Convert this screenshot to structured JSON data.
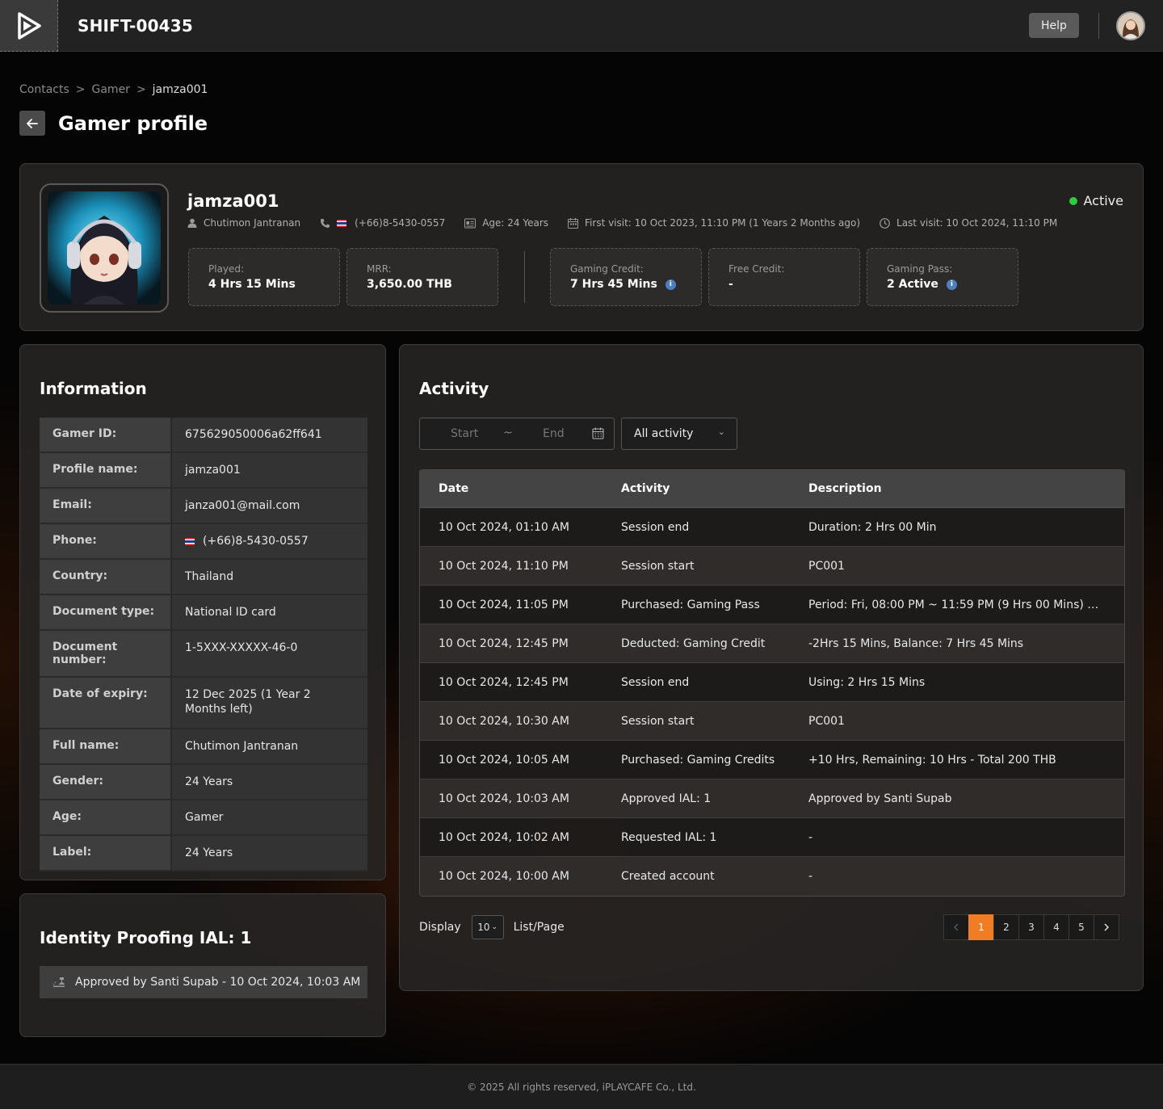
{
  "app": {
    "shift_id": "SHIFT-00435",
    "help_label": "Help"
  },
  "breadcrumb": [
    "Contacts",
    "Gamer",
    "jamza001"
  ],
  "page_title": "Gamer profile",
  "profile": {
    "name": "jamza001",
    "status": "Active",
    "status_color": "#2ecc40",
    "meta": {
      "full_name": "Chutimon Jantranan",
      "phone": "(+66)8-5430-0557",
      "age": "Age: 24 Years",
      "first_visit": "First visit: 10 Oct 2023, 11:10 PM (1 Years 2 Months ago)",
      "last_visit": "Last visit: 10 Oct 2024, 11:10 PM"
    },
    "stats": [
      {
        "label": "Played:",
        "value": "4 Hrs 15 Mins",
        "info": false
      },
      {
        "label": "MRR:",
        "value": "3,650.00 THB",
        "info": false
      },
      {
        "label": "Gaming Credit:",
        "value": "7 Hrs 45 Mins",
        "info": true
      },
      {
        "label": "Free Credit:",
        "value": "-",
        "info": false
      },
      {
        "label": "Gaming Pass:",
        "value": "2 Active",
        "info": true
      }
    ]
  },
  "information": {
    "title": "Information",
    "rows": [
      {
        "key": "Gamer ID:",
        "value": "675629050006a62ff641"
      },
      {
        "key": "Profile name:",
        "value": "jamza001"
      },
      {
        "key": "Email:",
        "value": "janza001@mail.com"
      },
      {
        "key": "Phone:",
        "value": "(+66)8-5430-0557"
      },
      {
        "key": "Country:",
        "value": "Thailand"
      },
      {
        "key": "Document type:",
        "value": "National ID card"
      },
      {
        "key": "Document number:",
        "value": "1-5XXX-XXXXX-46-0"
      },
      {
        "key": "Date of expiry:",
        "value": "12 Dec 2025 (1 Year 2 Months left)"
      },
      {
        "key": "Full name:",
        "value": "Chutimon Jantranan"
      },
      {
        "key": "Gender:",
        "value": "24 Years"
      },
      {
        "key": "Age:",
        "value": "Gamer"
      },
      {
        "key": "Label:",
        "value": "24 Years"
      }
    ]
  },
  "identity": {
    "title": "Identity Proofing IAL: 1",
    "approval": "Approved by Santi Supab - 10 Oct 2024, 10:03 AM"
  },
  "activity": {
    "title": "Activity",
    "date_start_placeholder": "Start",
    "date_separator": "~",
    "date_end_placeholder": "End",
    "filter_value": "All activity",
    "columns": [
      "Date",
      "Activity",
      "Description"
    ],
    "rows": [
      {
        "date": "10 Oct 2024, 01:10 AM",
        "activity": "Session end",
        "description": "Duration: 2 Hrs 00 Min"
      },
      {
        "date": "10 Oct 2024, 11:10 PM",
        "activity": "Session start",
        "description": "PC001"
      },
      {
        "date": "10 Oct 2024, 11:05 PM",
        "activity": "Purchased: Gaming Pass",
        "description": "Period: Fri, 08:00 PM ~ 11:59 PM (9 Hrs 00 Mins) - T..."
      },
      {
        "date": "10 Oct 2024, 12:45 PM",
        "activity": "Deducted: Gaming Credit",
        "description": "-2Hrs 15 Mins,  Balance: 7 Hrs 45 Mins"
      },
      {
        "date": "10 Oct 2024, 12:45 PM",
        "activity": "Session end",
        "description": "Using: 2 Hrs 15 Mins"
      },
      {
        "date": "10 Oct 2024, 10:30 AM",
        "activity": "Session start",
        "description": "PC001"
      },
      {
        "date": "10 Oct 2024, 10:05 AM",
        "activity": "Purchased: Gaming Credits",
        "description": "+10 Hrs, Remaining:  10 Hrs - Total 200 THB"
      },
      {
        "date": "10 Oct 2024, 10:03 AM",
        "activity": "Approved IAL: 1",
        "description": "Approved by Santi Supab"
      },
      {
        "date": "10 Oct 2024, 10:02 AM",
        "activity": "Requested IAL: 1",
        "description": "-"
      },
      {
        "date": "10 Oct 2024, 10:00 AM",
        "activity": "Created account",
        "description": "-"
      }
    ],
    "display_label": "Display",
    "per_page": "10",
    "list_page_label": "List/Page",
    "pages": [
      "1",
      "2",
      "3",
      "4",
      "5"
    ],
    "current_page": "1",
    "accent_color": "#f07c24"
  },
  "footer": "© 2025 All rights reserved, iPLAYCAFE Co., Ltd."
}
